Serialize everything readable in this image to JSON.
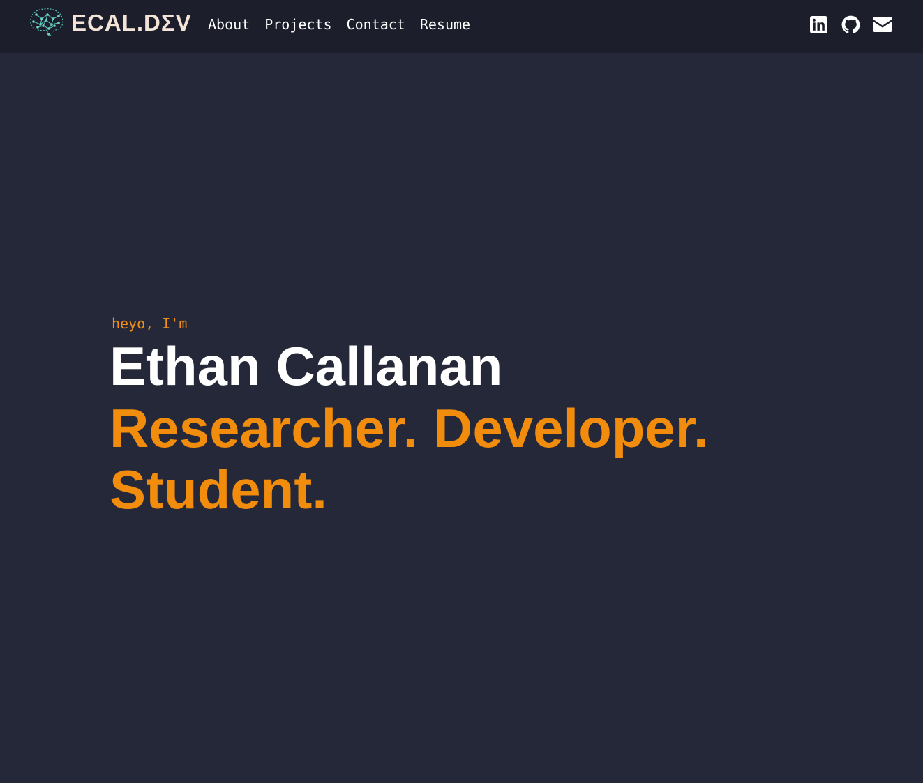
{
  "brand": {
    "name": "ECAL.DΣV",
    "logo_icon": "neural-brain-icon"
  },
  "nav": {
    "items": [
      {
        "label": "About"
      },
      {
        "label": "Projects"
      },
      {
        "label": "Contact"
      },
      {
        "label": "Resume"
      }
    ]
  },
  "socials": [
    {
      "name": "linkedin-icon"
    },
    {
      "name": "github-icon"
    },
    {
      "name": "email-icon"
    }
  ],
  "hero": {
    "greeting": "heyo, I'm",
    "name": "Ethan Callanan",
    "tagline": "Researcher. Developer. Student."
  },
  "colors": {
    "background": "#252839",
    "navbar": "#1c1e2b",
    "accent": "#f28c0d",
    "text": "#ffffff",
    "brand_text": "#f4e4d8",
    "logo": "#4fc1b4"
  }
}
